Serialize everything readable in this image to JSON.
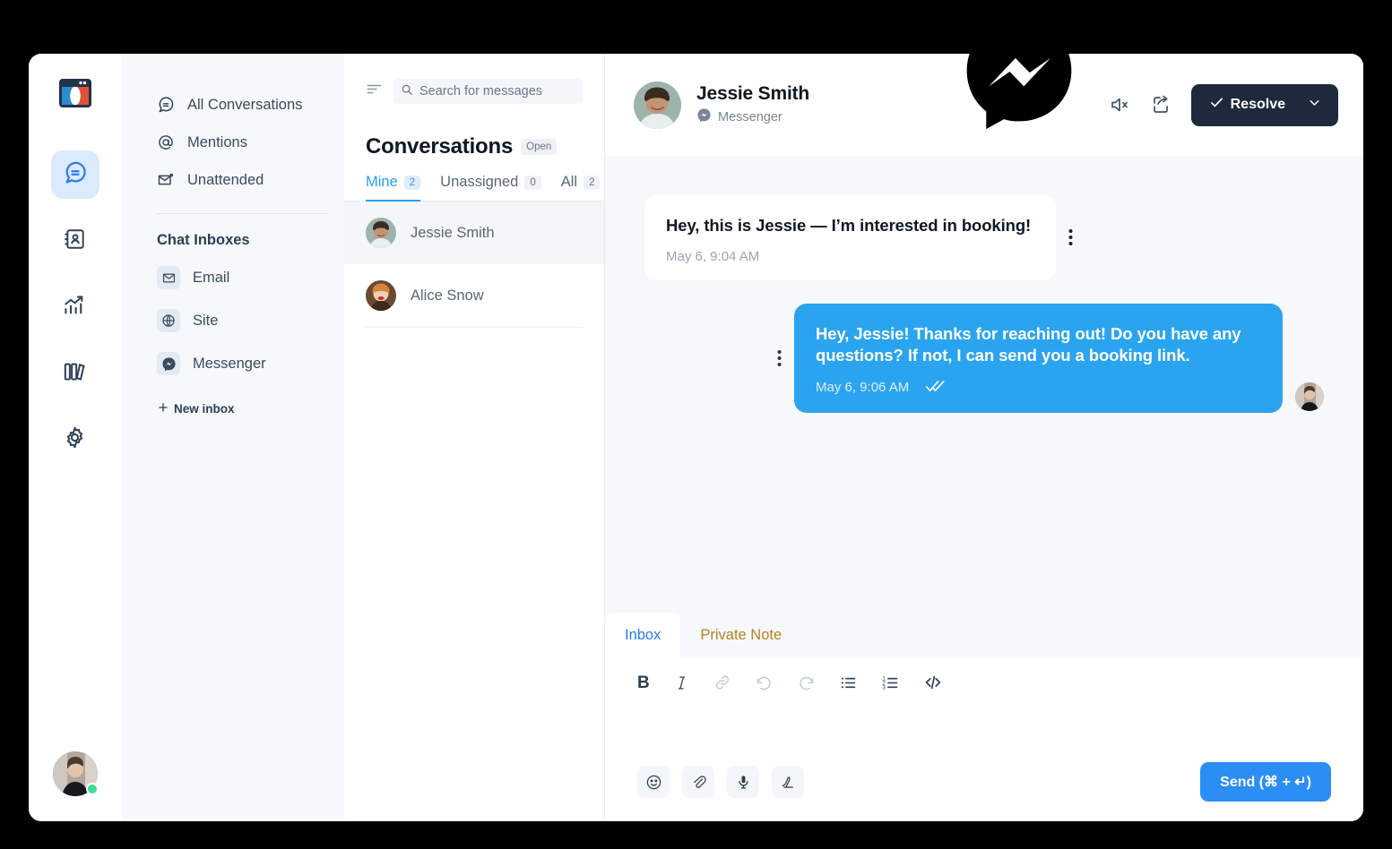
{
  "brand": {
    "logo_icon": "app-window-logo"
  },
  "rail": {
    "items": [
      {
        "name": "conversations",
        "icon": "chat-bubble-icon",
        "active": true
      },
      {
        "name": "contacts",
        "icon": "contact-book-icon",
        "active": false
      },
      {
        "name": "reports",
        "icon": "trend-chart-icon",
        "active": false
      },
      {
        "name": "library",
        "icon": "books-icon",
        "active": false
      },
      {
        "name": "settings",
        "icon": "gear-icon",
        "active": false
      }
    ],
    "avatar": {
      "name": "user-avatar",
      "status": "online",
      "status_color": "#3ddc97"
    }
  },
  "folder_nav": {
    "items": [
      {
        "label": "All Conversations",
        "icon": "chat-bubble-icon"
      },
      {
        "label": "Mentions",
        "icon": "at-sign-icon"
      },
      {
        "label": "Unattended",
        "icon": "envelope-dot-icon"
      }
    ],
    "section_title": "Chat Inboxes",
    "inboxes": [
      {
        "label": "Email",
        "icon": "envelope-icon"
      },
      {
        "label": "Site",
        "icon": "globe-icon"
      },
      {
        "label": "Messenger",
        "icon": "messenger-icon"
      }
    ],
    "new_inbox_label": "New inbox"
  },
  "conv_list": {
    "search": {
      "placeholder": "Search for messages",
      "value": "",
      "icon": "search-icon"
    },
    "filter_icon": "filter-lines-icon",
    "title": "Conversations",
    "status_badge": "Open",
    "tabs": [
      {
        "label": "Mine",
        "count": "2",
        "active": true
      },
      {
        "label": "Unassigned",
        "count": "0",
        "active": false
      },
      {
        "label": "All",
        "count": "2",
        "active": false
      }
    ],
    "rows": [
      {
        "name": "Jessie Smith",
        "selected": true
      },
      {
        "name": "Alice Snow",
        "selected": false
      }
    ]
  },
  "chat": {
    "contact_name": "Jessie Smith",
    "channel": "Messenger",
    "channel_icon": "messenger-icon",
    "actions": {
      "mute_icon": "speaker-mute-icon",
      "share_icon": "share-export-icon",
      "resolve_label": "Resolve",
      "resolve_check_icon": "check-icon",
      "resolve_caret_icon": "chevron-down-icon"
    },
    "overlay_logo_icon": "messenger-logo",
    "messages": [
      {
        "direction": "in",
        "text": "Hey, this is Jessie — I’m interested in booking!",
        "time": "May 6, 9:04 AM",
        "read_receipt": ""
      },
      {
        "direction": "out",
        "text": "Hey, Jessie! Thanks for reaching out! Do you have any questions? If not, I can send you a booking link.",
        "time": "May 6, 9:06 AM",
        "read_receipt": "double-check-icon"
      }
    ]
  },
  "composer": {
    "tabs": [
      {
        "label": "Inbox",
        "active": true
      },
      {
        "label": "Private Note",
        "active": false
      }
    ],
    "format_tools": [
      {
        "name": "bold",
        "glyph": "B",
        "dim": false
      },
      {
        "name": "italic",
        "glyph": "I",
        "dim": false
      },
      {
        "name": "link",
        "glyph": "link-icon",
        "dim": true
      },
      {
        "name": "undo",
        "glyph": "undo-icon",
        "dim": true
      },
      {
        "name": "redo",
        "glyph": "redo-icon",
        "dim": true
      },
      {
        "name": "bullet-list",
        "glyph": "bullet-list-icon",
        "dim": false
      },
      {
        "name": "numbered-list",
        "glyph": "numbered-list-icon",
        "dim": false
      },
      {
        "name": "code",
        "glyph": "code-icon",
        "dim": false
      }
    ],
    "editor_value": "",
    "editor_placeholder": "",
    "attach_tools": [
      {
        "name": "emoji",
        "icon": "smiley-icon"
      },
      {
        "name": "attachment",
        "icon": "paperclip-icon"
      },
      {
        "name": "voice",
        "icon": "microphone-icon"
      },
      {
        "name": "signature",
        "icon": "signature-icon"
      }
    ],
    "send_label": "Send (⌘ + ↵)"
  },
  "colors": {
    "accent_blue": "#2b9cf5",
    "bubble_blue": "#2ba4f0",
    "resolve_dark": "#1e2a3b",
    "panel_gray": "#f6f8fb",
    "note_gold": "#b5831c",
    "page_bg": "#000000"
  }
}
